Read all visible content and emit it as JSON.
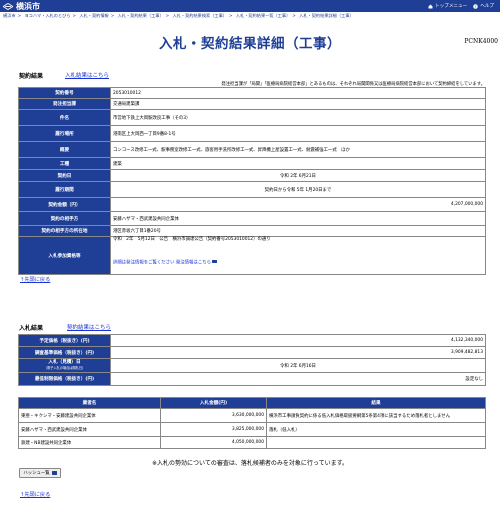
{
  "header": {
    "city_name": "横浜市",
    "links": [
      {
        "label": "トップメニュー",
        "icon": "home-icon"
      },
      {
        "label": "ヘルプ",
        "icon": "help-icon"
      }
    ]
  },
  "breadcrumb": [
    "横浜市",
    "ヨコハマ・入札のとびら",
    "入札・契約情報",
    "入札・契約結果（工事）",
    "入札・契約結果検索（工事）",
    "入札・契約結果一覧（工事）",
    "入札・契約結果詳細（工事）"
  ],
  "page": {
    "title": "入札・契約結果詳細（工事）",
    "code": "PCNK4000"
  },
  "contract": {
    "section_title": "契約結果",
    "link": "入札結果はこちら",
    "note": "発注担当課が「局関」「医療局病院経営本部」とあるものは、それぞれ局関関係又は医療局病院経営本部において契約締結をしています。",
    "rows": [
      {
        "label": "契約番号",
        "value": "2053010012"
      },
      {
        "label": "発注担当課",
        "value": "交通局建築課"
      },
      {
        "label": "件名",
        "value": "市営地下鉄上大岡駅改良工事（その3）"
      },
      {
        "label": "履行場所",
        "value": "港南区上大岡西一丁目9番8-1号"
      },
      {
        "label": "概要",
        "value": "コンコース改修工一式、駅事務室改修工一式、旅客用手洗所改修工一式、昇降機上屋設置工一式、耐震補強工一式　ほか"
      },
      {
        "label": "工種",
        "value": "建築"
      },
      {
        "label": "契約日",
        "value": "令和 2年 6月21日"
      },
      {
        "label": "履行期間",
        "value": "契約日から令和 5年 1月20日まで"
      },
      {
        "label": "契約金額（円）",
        "value": "4,207,000,000"
      },
      {
        "label": "契約の相手方",
        "value": "安藤ハザマ・西武建設共同企業体"
      },
      {
        "label": "契約の相手方の所在地",
        "value": "港区赤坂六丁目1番20号"
      },
      {
        "label": "入札参加資格等",
        "value": "令和　2年　5月12日　公告　横浜市調達公告（契約番号2053010012）の通り",
        "extra": "詳細は発注情報をご覧ください 発注情報はこちら"
      }
    ],
    "back": "↑先頭に戻る"
  },
  "bid": {
    "section_title": "入札結果",
    "link": "契約結果はこちら",
    "rows": [
      {
        "label": "予定価格（税抜き）(円)",
        "value": "4,132,340,000"
      },
      {
        "label": "調査基準価格（税抜き）(円)",
        "value": "3,909,482,813"
      },
      {
        "label": "入札（見積）日",
        "sub": "(電子入札の場合は開札日)",
        "value": "令和 2年 6月16日"
      },
      {
        "label": "最低制限価格（税抜き）(円)",
        "value": "設定なし"
      }
    ],
    "columns": [
      "業者名",
      "入札金額(円)",
      "結果"
    ],
    "bidders": [
      {
        "name": "東亜・キクシマ・安藤建設共同企業体",
        "amount": "3,630,000,000",
        "result": "横浜市工事請負契約に係る低入札価格取扱要綱第5条第4項に該当するため落札者としません"
      },
      {
        "name": "安藤ハザマ・西武建設共同企業体",
        "amount": "3,825,000,000",
        "result": "落札（低入札）"
      },
      {
        "name": "鉄建・NB建設共同企業体",
        "amount": "4,050,000,000",
        "result": ""
      }
    ],
    "remark": "※入札の勢効についての審査は、落札候補者のみを対象に行っています。",
    "hash_button": "ハッシュー覧",
    "back": "↑先頭に戻る"
  },
  "colors": {
    "accent": "#1f3f96",
    "link": "#1a33d6"
  }
}
